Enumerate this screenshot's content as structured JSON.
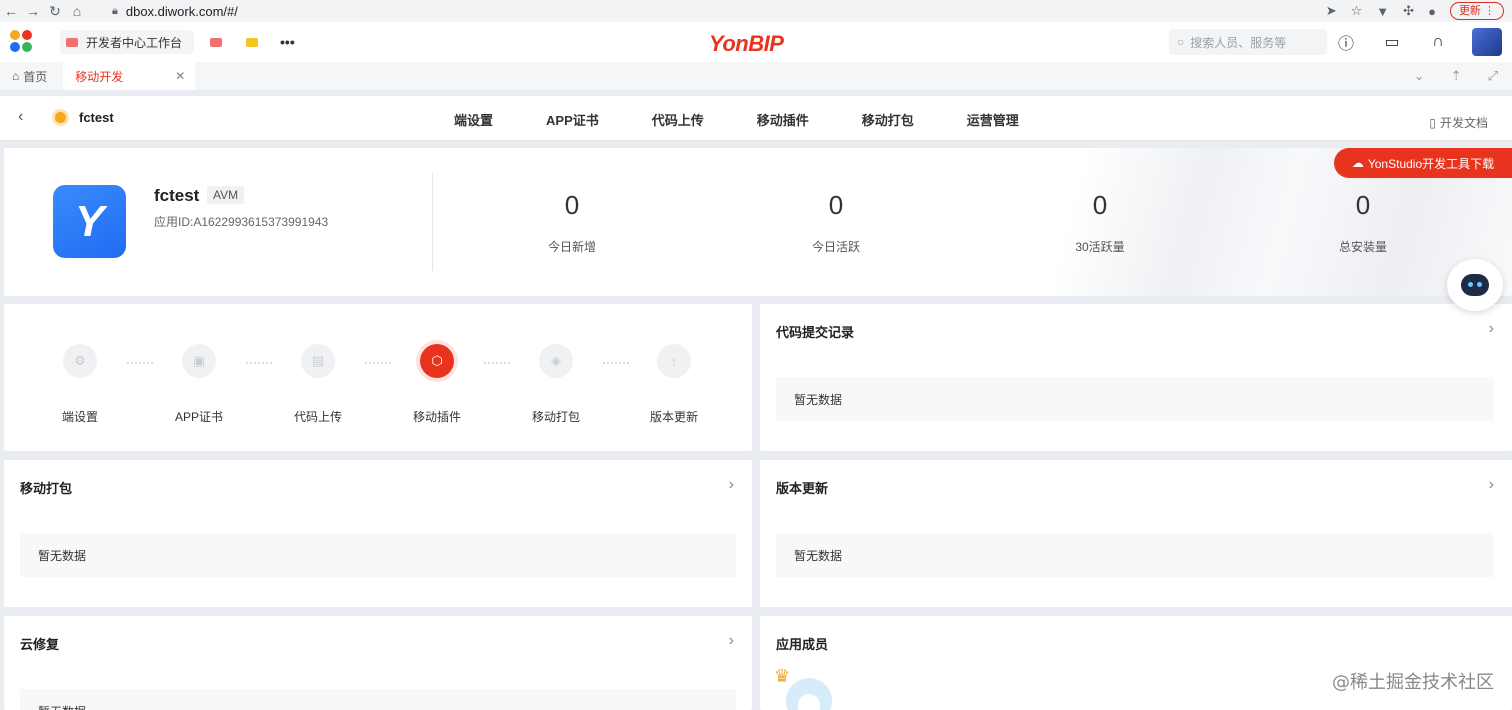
{
  "browser": {
    "url": "dbox.diwork.com/#/",
    "update_label": "更新"
  },
  "appbar": {
    "tab_label": "开发者中心工作台",
    "brand": "YonBIP",
    "search_placeholder": "搜索人员、服务等"
  },
  "tabs": {
    "home_label": "首页",
    "active_label": "移动开发"
  },
  "subnav": {
    "app_name": "fctest",
    "menu": [
      "端设置",
      "APP证书",
      "代码上传",
      "移动插件",
      "移动打包",
      "运营管理"
    ],
    "doc_label": "开发文档"
  },
  "hero": {
    "app_name": "fctest",
    "badge": "AVM",
    "app_id": "应用ID:A1622993615373991943",
    "download_label": "YonStudio开发工具下载",
    "stats": [
      {
        "value": "0",
        "label": "今日新增"
      },
      {
        "value": "0",
        "label": "今日活跃"
      },
      {
        "value": "0",
        "label": "30活跃量"
      },
      {
        "value": "0",
        "label": "总安装量"
      }
    ]
  },
  "steps": [
    {
      "label": "端设置",
      "active": false
    },
    {
      "label": "APP证书",
      "active": false
    },
    {
      "label": "代码上传",
      "active": false
    },
    {
      "label": "移动插件",
      "active": true
    },
    {
      "label": "移动打包",
      "active": false
    },
    {
      "label": "版本更新",
      "active": false
    }
  ],
  "cards": {
    "code_records": {
      "title": "代码提交记录",
      "empty": "暂无数据"
    },
    "packaging": {
      "title": "移动打包",
      "empty": "暂无数据"
    },
    "version": {
      "title": "版本更新",
      "empty": "暂无数据"
    },
    "cloud_fix": {
      "title": "云修复",
      "empty": "暂无数据"
    },
    "members": {
      "title": "应用成员"
    }
  },
  "watermark": "@稀土掘金技术社区",
  "colors": {
    "accent": "#e8341f",
    "app_icon": "#1f6cf0",
    "page_bg": "#e9ecf1"
  }
}
